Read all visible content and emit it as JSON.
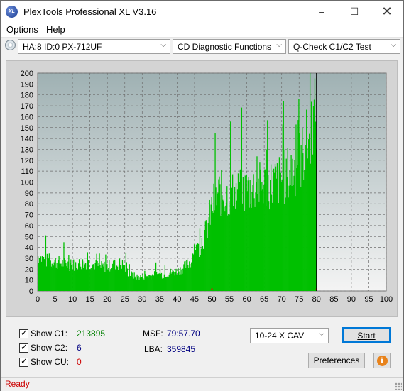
{
  "window": {
    "title": "PlexTools Professional XL V3.16",
    "app_icon_text": "XL",
    "controls": [
      "minimize-icon",
      "maximize-icon",
      "close-icon"
    ]
  },
  "menu": {
    "items": [
      "Options",
      "Help"
    ]
  },
  "toolbar": {
    "drive": "HA:8 ID:0  PX-712UF",
    "function": "CD Diagnostic Functions",
    "test": "Q-Check C1/C2 Test"
  },
  "chart_data": {
    "type": "bar",
    "title": "",
    "xlabel": "",
    "ylabel": "",
    "xlim": [
      0,
      100
    ],
    "ylim": [
      0,
      200
    ],
    "x_ticks": [
      0,
      5,
      10,
      15,
      20,
      25,
      30,
      35,
      40,
      45,
      50,
      55,
      60,
      65,
      70,
      75,
      80,
      85,
      90,
      95,
      100
    ],
    "y_ticks": [
      0,
      10,
      20,
      30,
      40,
      50,
      60,
      70,
      80,
      90,
      100,
      110,
      120,
      130,
      140,
      150,
      160,
      170,
      180,
      190,
      200
    ],
    "grid": true,
    "series": [
      {
        "color": "#00c000",
        "x": [
          0,
          2,
          4,
          6,
          8,
          10,
          12,
          14,
          16,
          18,
          20,
          22,
          24,
          26,
          28,
          30,
          32,
          34,
          36,
          38,
          40,
          42,
          44,
          46,
          48,
          50,
          52,
          54,
          56,
          58,
          60,
          62,
          64,
          66,
          68,
          70,
          72,
          74,
          76,
          78,
          80
        ],
        "values": [
          32,
          28,
          27,
          26,
          25,
          24,
          25,
          26,
          24,
          22,
          23,
          24,
          25,
          16,
          13,
          13,
          14,
          15,
          15,
          17,
          18,
          22,
          28,
          40,
          52,
          78,
          90,
          88,
          89,
          90,
          93,
          95,
          96,
          98,
          99,
          103,
          108,
          115,
          125,
          145,
          165
        ]
      },
      {
        "color": "#ff0000",
        "x": [
          50,
          80
        ],
        "values": [
          1,
          1
        ]
      }
    ],
    "end_marker_x": 80,
    "end_marker_color": "#000000"
  },
  "stats": {
    "c1_label": "Show C1:",
    "c1_value": "213895",
    "c2_label": "Show C2:",
    "c2_value": "6",
    "cu_label": "Show CU:",
    "cu_value": "0",
    "msf_label": "MSF:",
    "msf_value": "79:57.70",
    "lba_label": "LBA:",
    "lba_value": "359845",
    "colors": {
      "c1": "#008000",
      "c2": "#000080",
      "cu": "#cc0000",
      "msf": "#000080"
    }
  },
  "controls": {
    "speed": "10-24 X CAV",
    "start": "Start",
    "preferences": "Preferences",
    "info_icon": "info-icon"
  },
  "status": {
    "text": "Ready",
    "color": "#cc0000"
  }
}
